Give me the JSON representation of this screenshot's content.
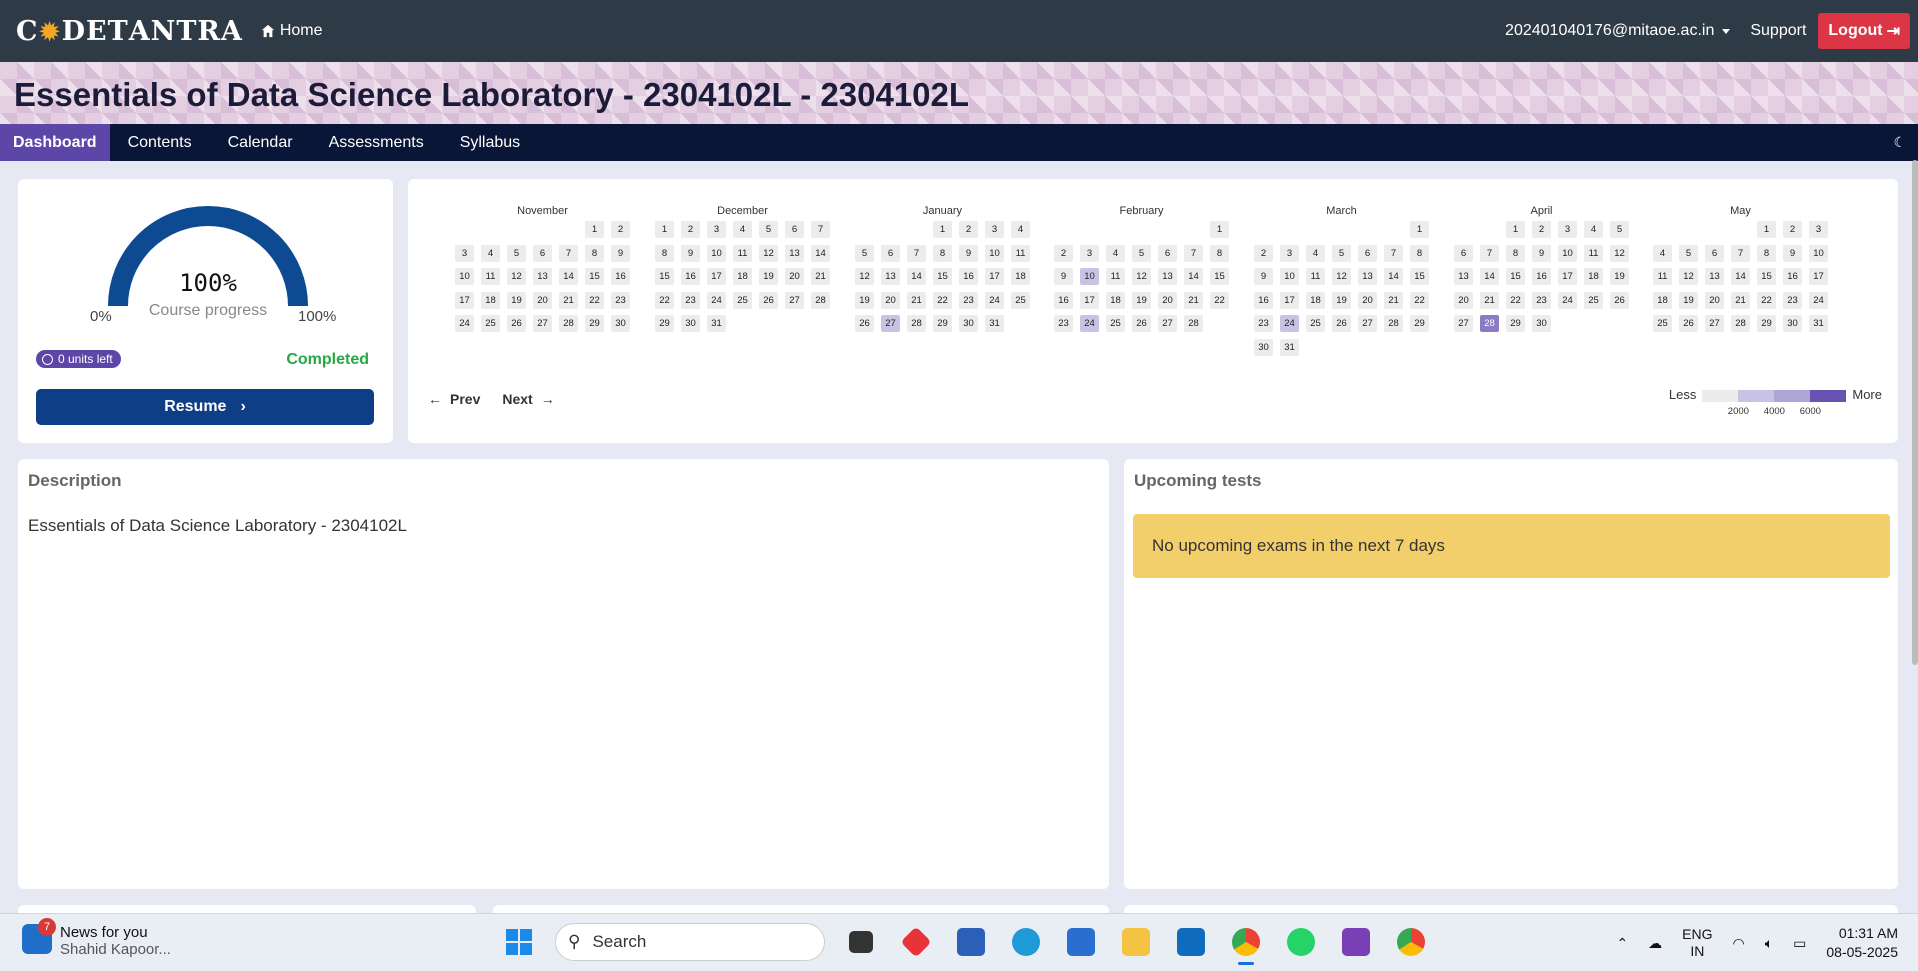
{
  "navbar": {
    "logo": "CODETANTRA",
    "home_label": "Home",
    "user_email": "202401040176@mitaoe.ac.in",
    "support_label": "Support",
    "logout_label": "Logout"
  },
  "course": {
    "title": "Essentials of Data Science Laboratory - 2304102L - 2304102L"
  },
  "tabs": [
    "Dashboard",
    "Contents",
    "Calendar",
    "Assessments",
    "Syllabus"
  ],
  "progress": {
    "percent_text": "100%",
    "percent_value": 100,
    "label": "Course progress",
    "min_label": "0%",
    "max_label": "100%",
    "units_left": "0 units left",
    "status": "Completed",
    "resume_label": "Resume"
  },
  "calendar": {
    "prev_label": "Prev",
    "next_label": "Next",
    "legend_less": "Less",
    "legend_more": "More",
    "legend_ticks": [
      "2000",
      "4000",
      "6000"
    ],
    "legend_colors": [
      "#ececec",
      "#c8c3e4",
      "#aea4d6",
      "#6a54b3"
    ],
    "months": [
      {
        "name": "November",
        "start": 5,
        "days": 30,
        "active": {}
      },
      {
        "name": "December",
        "start": 0,
        "days": 31,
        "active": {}
      },
      {
        "name": "January",
        "start": 3,
        "days": 31,
        "active": {
          "27": 1
        }
      },
      {
        "name": "February",
        "start": 6,
        "days": 28,
        "active": {
          "10": 1,
          "24": 1
        }
      },
      {
        "name": "March",
        "start": 6,
        "days": 31,
        "active": {
          "24": 1
        }
      },
      {
        "name": "April",
        "start": 2,
        "days": 30,
        "active": {
          "28": 3
        }
      },
      {
        "name": "May",
        "start": 4,
        "days": 31,
        "active": {}
      }
    ]
  },
  "description": {
    "heading": "Description",
    "text": "Essentials of Data Science Laboratory - 2304102L"
  },
  "upcoming": {
    "heading": "Upcoming tests",
    "alert": "No upcoming exams in the next 7 days"
  },
  "taskbar": {
    "news_title": "News for you",
    "news_subtitle": "Shahid Kapoor...",
    "news_badge": "7",
    "search_placeholder": "Search",
    "lang_line1": "ENG",
    "lang_line2": "IN",
    "time": "01:31 AM",
    "date": "08-05-2025"
  }
}
